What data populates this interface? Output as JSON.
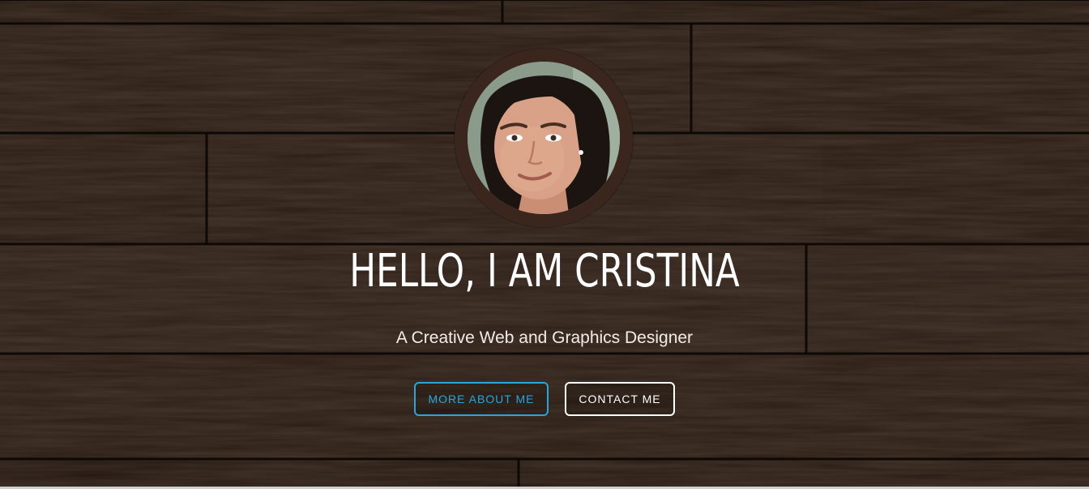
{
  "hero": {
    "title": "HELLO, I AM CRISTINA",
    "subtitle": "A Creative Web and Graphics Designer",
    "buttons": {
      "more_about_label": "MORE ABOUT ME",
      "contact_label": "CONTACT ME"
    }
  },
  "colors": {
    "accent": "#2aa6dc",
    "wood_dark": "#1f140e",
    "wood_mid": "#2e1e15",
    "ring": "#3a261c",
    "text": "#ffffff"
  },
  "icons": {
    "profile": "profile-photo"
  }
}
